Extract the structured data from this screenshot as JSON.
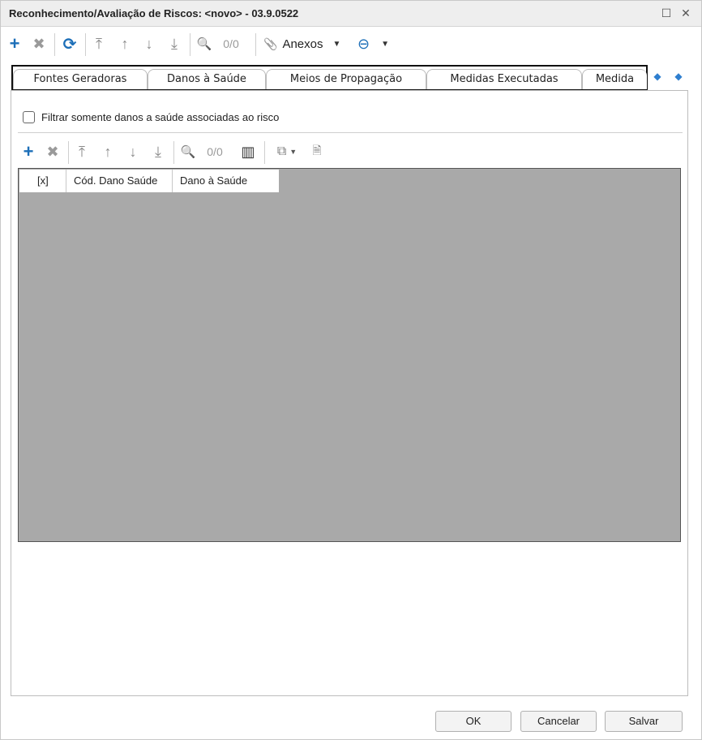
{
  "window": {
    "title": "Reconhecimento/Avaliação de Riscos: <novo> - 03.9.0522",
    "maximize_glyph": "☐",
    "close_glyph": "✕"
  },
  "toolbar": {
    "icons": {
      "add": "+",
      "delete": "✖",
      "refresh": "⟳",
      "first": "⤒",
      "prev": "↑",
      "next": "↓",
      "last": "⤓",
      "search": "🔍",
      "anexos_clip": "📎",
      "anexos_caret": "▼",
      "options_icon": "⊖",
      "options_caret": "▼"
    },
    "counter": "0/0",
    "anexos_label": "Anexos"
  },
  "tabs": [
    {
      "label": "Fontes Geradoras"
    },
    {
      "label": "Danos à Saúde"
    },
    {
      "label": "Meios de Propagação"
    },
    {
      "label": "Medidas Executadas"
    },
    {
      "label": "Medida"
    }
  ],
  "tab_nav": {
    "left": "◆",
    "right": "◆"
  },
  "filter": {
    "label": "Filtrar somente danos a saúde associadas ao risco",
    "checked": false
  },
  "grid_toolbar": {
    "icons": {
      "add": "+",
      "delete": "✖",
      "first": "⤒",
      "prev": "↑",
      "next": "↓",
      "last": "⤓",
      "search": "🔍",
      "columns": "▥",
      "export": "⧉",
      "export_caret": "▼",
      "document": "🗎"
    },
    "counter": "0/0"
  },
  "grid": {
    "columns": [
      "[x]",
      "Cód. Dano Saúde",
      "Dano à Saúde"
    ],
    "rows": []
  },
  "buttons": {
    "ok": "OK",
    "cancel": "Cancelar",
    "save": "Salvar"
  },
  "colors": {
    "accent": "#1d6fb8",
    "grid_background": "#a9a9a9"
  }
}
